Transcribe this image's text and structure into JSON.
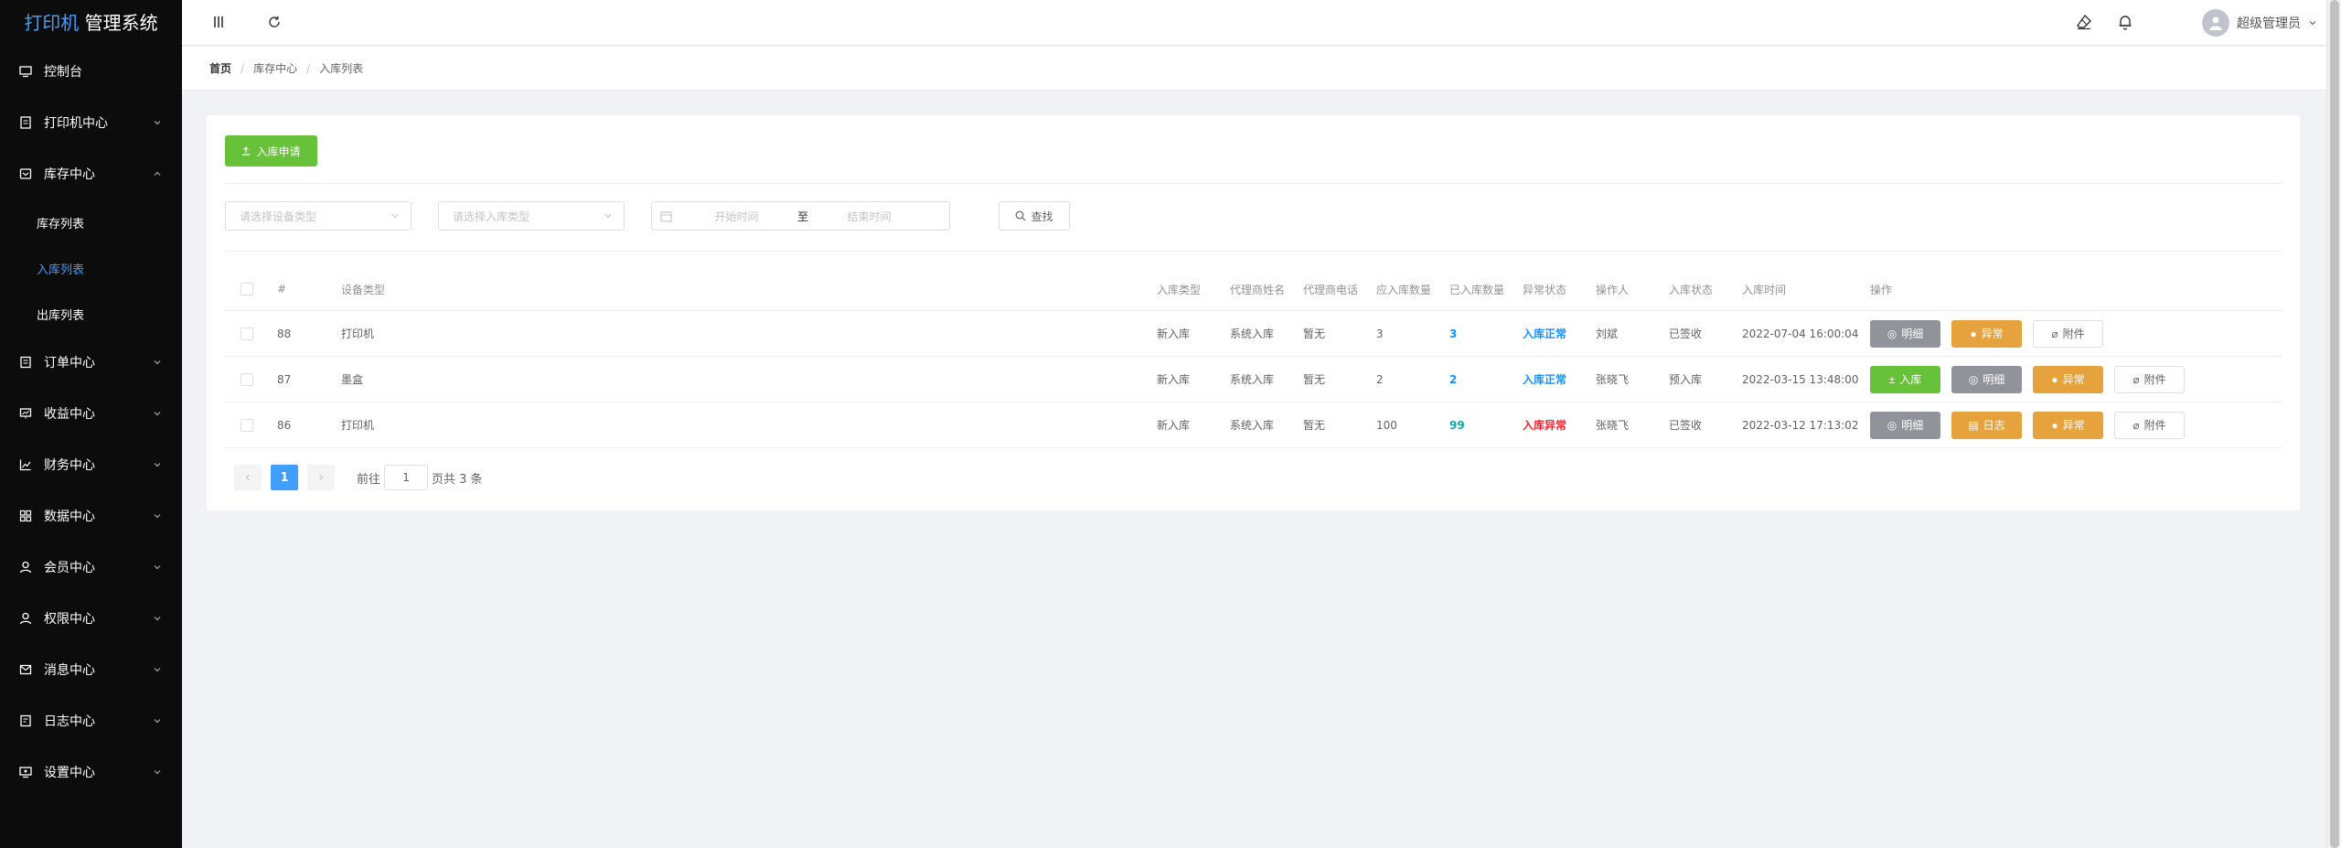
{
  "app": {
    "title_accent": "打印机",
    "title_rest": " 管理系统"
  },
  "sidebar": {
    "items": [
      {
        "label": "控制台",
        "icon": "monitor-icon"
      },
      {
        "label": "打印机中心",
        "icon": "document-icon"
      },
      {
        "label": "库存中心",
        "icon": "inbox-icon"
      },
      {
        "label": "订单中心",
        "icon": "list-icon"
      },
      {
        "label": "收益中心",
        "icon": "chart-icon"
      },
      {
        "label": "财务中心",
        "icon": "trend-icon"
      },
      {
        "label": "数据中心",
        "icon": "grid-icon"
      },
      {
        "label": "会员中心",
        "icon": "user-icon"
      },
      {
        "label": "权限中心",
        "icon": "user-lock-icon"
      },
      {
        "label": "消息中心",
        "icon": "message-icon"
      },
      {
        "label": "日志中心",
        "icon": "log-icon"
      },
      {
        "label": "设置中心",
        "icon": "settings-monitor-icon"
      }
    ],
    "sub": [
      "库存列表",
      "入库列表",
      "出库列表"
    ]
  },
  "header": {
    "user_name": "超级管理员"
  },
  "breadcrumb": [
    "首页",
    "库存中心",
    "入库列表"
  ],
  "toolbar": {
    "apply_label": "入库申请"
  },
  "filters": {
    "device_type_placeholder": "请选择设备类型",
    "in_type_placeholder": "请选择入库类型",
    "start_placeholder": "开始时间",
    "range_sep": "至",
    "end_placeholder": "结束时间",
    "search_label": "查找"
  },
  "table": {
    "headers": [
      "#",
      "设备类型",
      "入库类型",
      "代理商姓名",
      "代理商电话",
      "应入库数量",
      "已入库数量",
      "异常状态",
      "操作人",
      "入库状态",
      "入库时间",
      "操作"
    ],
    "rows": [
      {
        "id": "88",
        "device": "打印机",
        "in_type": "新入库",
        "agent": "系统入库",
        "phone": "暂无",
        "expected": "3",
        "received": "3",
        "abnormal": "入库正常",
        "operator": "刘斌",
        "status": "已签收",
        "time": "2022-07-04 16:00:04"
      },
      {
        "id": "87",
        "device": "墨盒",
        "in_type": "新入库",
        "agent": "系统入库",
        "phone": "暂无",
        "expected": "2",
        "received": "2",
        "abnormal": "入库正常",
        "operator": "张晓飞",
        "status": "预入库",
        "time": "2022-03-15 13:48:00"
      },
      {
        "id": "86",
        "device": "打印机",
        "in_type": "新入库",
        "agent": "系统入库",
        "phone": "暂无",
        "expected": "100",
        "received": "99",
        "abnormal": "入库异常",
        "operator": "张晓飞",
        "status": "已签收",
        "time": "2022-03-12 17:13:02"
      }
    ],
    "ops": {
      "detail": "明细",
      "abnormal": "异常",
      "attach": "附件",
      "in": "入库",
      "log": "日志"
    }
  },
  "pagination": {
    "current": "1",
    "goto_prefix": "前往",
    "goto_value": "1",
    "goto_suffix": "页共 3 条"
  }
}
